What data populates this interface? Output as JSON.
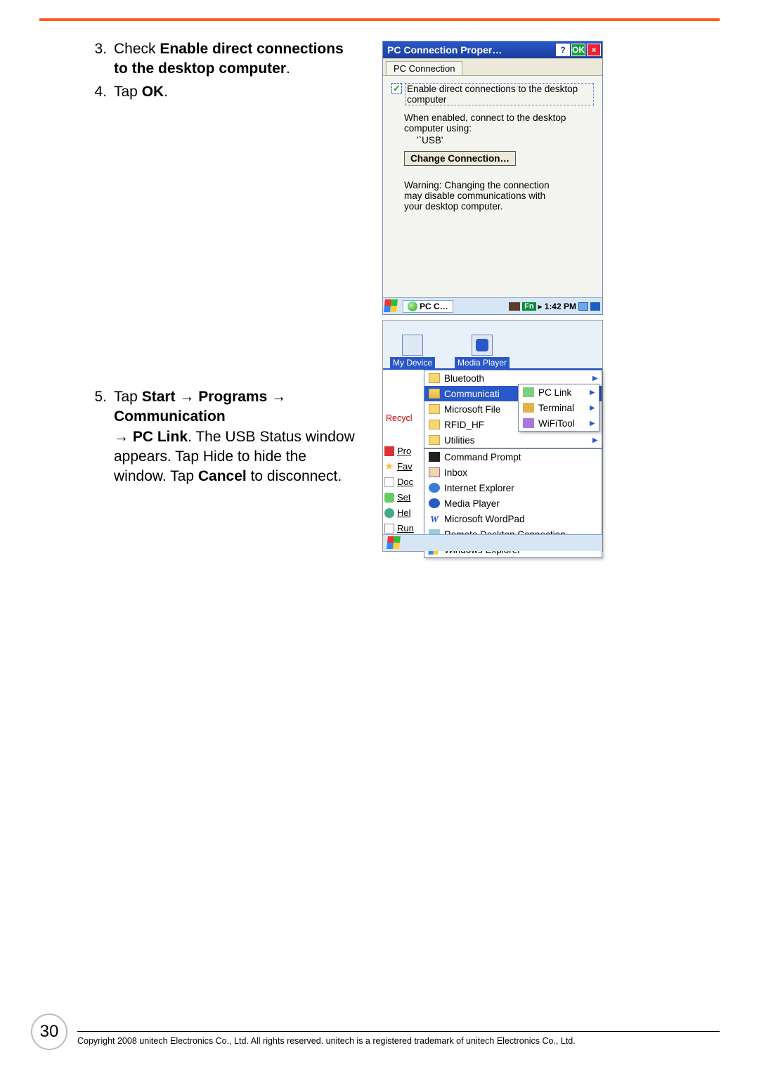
{
  "steps": {
    "s3": {
      "num": "3.",
      "prefix": "Check ",
      "bold": "Enable direct connections to the desktop computer",
      "suffix": "."
    },
    "s4": {
      "num": "4.",
      "prefix": "Tap ",
      "bold": "OK",
      "suffix": "."
    },
    "s5": {
      "num": "5.",
      "t1": "Tap ",
      "b1": "Start",
      "arr1": " → ",
      "b2": "Programs",
      "arr2": " → ",
      "b3": "Communication",
      "arr3": " → ",
      "b4": "PC Link",
      "t2": ". The USB Status window appears. Tap Hide to hide the window. Tap ",
      "b5": "Cancel",
      "t3": " to disconnect."
    }
  },
  "shot1": {
    "title": "PC Connection Proper…",
    "help": "?",
    "ok": "OK",
    "close": "×",
    "tab": "PC Connection",
    "checkbox_label": "Enable direct connections to the desktop computer",
    "when_enabled": "When enabled, connect to the desktop computer using:",
    "usb": "'`USB'",
    "change_btn": "Change Connection…",
    "warning": "Warning: Changing the connection may disable communications with your desktop computer.",
    "task_label": "PC C…",
    "time": "1:42 PM",
    "fn": "Fn",
    "arrow": "▸"
  },
  "shot2": {
    "desktop": {
      "my_device": "My Device",
      "media_player": "Media Player",
      "recycle": "Recycl"
    },
    "side": {
      "pro": "Pro",
      "fav": "Fav",
      "doc": "Doc",
      "set": "Set",
      "hel": "Hel",
      "run": "Run"
    },
    "programs_menu": [
      "Bluetooth",
      "Communicati",
      "Microsoft File",
      "RFID_HF",
      "Utilities"
    ],
    "comm_submenu": [
      "PC Link",
      "Terminal",
      "WiFiTool"
    ],
    "lower_menu": [
      "Command Prompt",
      "Inbox",
      "Internet Explorer",
      "Media Player",
      "Microsoft WordPad",
      "Remote Desktop Connection",
      "Windows Explorer"
    ]
  },
  "page_number": "30",
  "footer": "Copyright 2008 unitech Electronics Co., Ltd. All rights reserved. unitech is a registered trademark of unitech Electronics Co., Ltd."
}
